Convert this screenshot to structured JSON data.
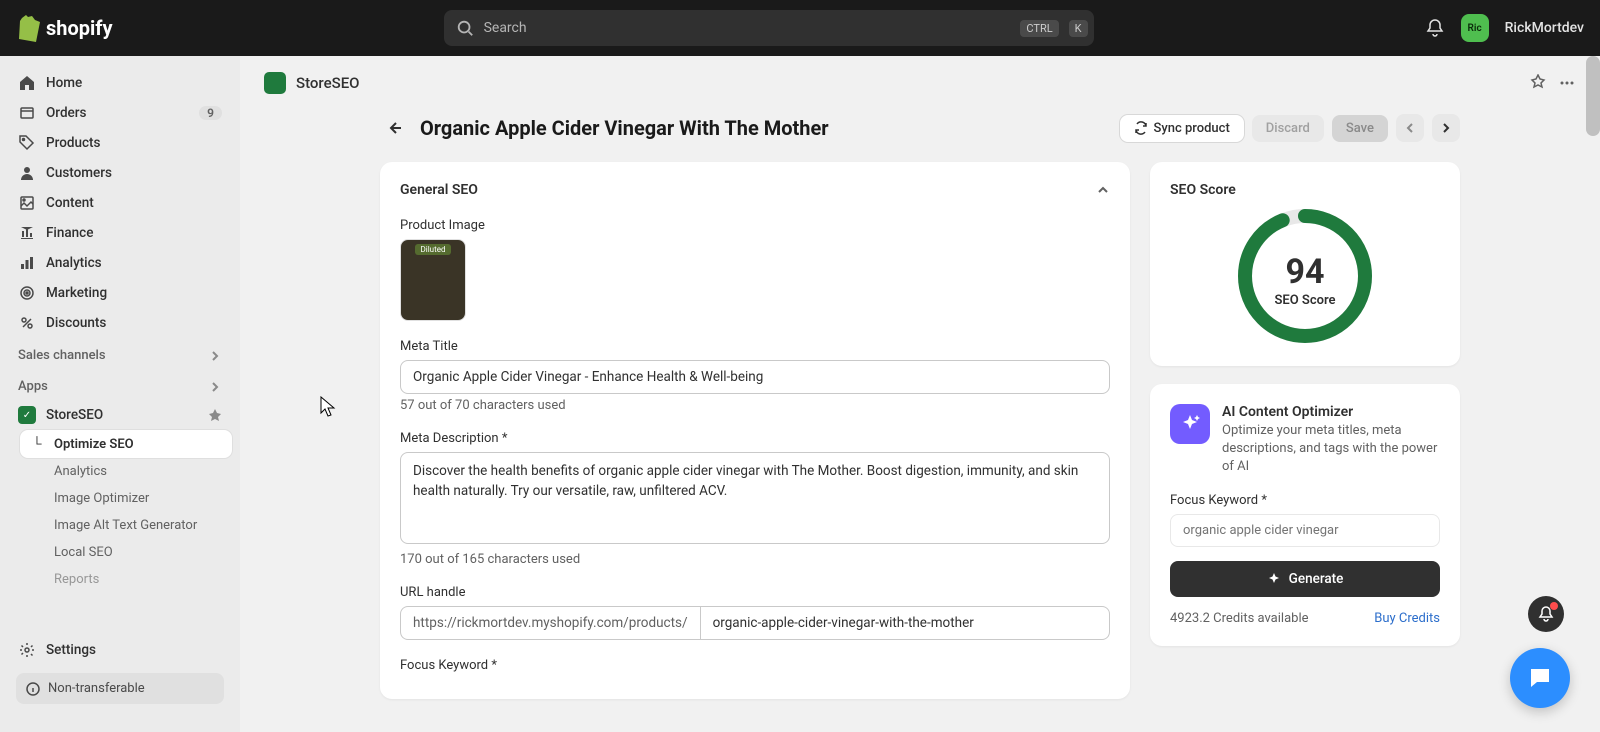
{
  "topbar": {
    "brand": "shopify",
    "search_placeholder": "Search",
    "kbd_ctrl": "CTRL",
    "kbd_k": "K",
    "avatar_initials": "Ric",
    "username": "RickMortdev"
  },
  "sidebar": {
    "items": [
      {
        "label": "Home"
      },
      {
        "label": "Orders",
        "badge": "9"
      },
      {
        "label": "Products"
      },
      {
        "label": "Customers"
      },
      {
        "label": "Content"
      },
      {
        "label": "Finance"
      },
      {
        "label": "Analytics"
      },
      {
        "label": "Marketing"
      },
      {
        "label": "Discounts"
      }
    ],
    "sales_channels": "Sales channels",
    "apps_header": "Apps",
    "app_name": "StoreSEO",
    "sub": [
      {
        "label": "Optimize SEO"
      },
      {
        "label": "Analytics"
      },
      {
        "label": "Image Optimizer"
      },
      {
        "label": "Image Alt Text Generator"
      },
      {
        "label": "Local SEO"
      },
      {
        "label": "Reports"
      }
    ],
    "settings": "Settings",
    "non_transferable": "Non-transferable"
  },
  "app_header": {
    "title": "StoreSEO"
  },
  "page": {
    "title": "Organic Apple Cider Vinegar With The Mother",
    "sync": "Sync product",
    "discard": "Discard",
    "save": "Save"
  },
  "general": {
    "title": "General SEO",
    "product_image_label": "Product Image",
    "product_image_tag": "Diluted",
    "meta_title_label": "Meta Title",
    "meta_title_value": "Organic Apple Cider Vinegar - Enhance Health & Well-being",
    "meta_title_helper": "57 out of 70 characters used",
    "meta_desc_label": "Meta Description",
    "meta_desc_value": "Discover the health benefits of organic apple cider vinegar with The Mother. Boost digestion, immunity, and skin health naturally. Try our versatile, raw, unfiltered ACV.",
    "meta_desc_helper": "170 out of 165 characters used",
    "url_label": "URL handle",
    "url_prefix": "https://rickmortdev.myshopify.com/products/",
    "url_value": "organic-apple-cider-vinegar-with-the-mother",
    "focus_keyword_label": "Focus Keyword"
  },
  "score": {
    "title": "SEO Score",
    "value": "94",
    "sub": "SEO Score"
  },
  "ai": {
    "title": "AI Content Optimizer",
    "desc": "Optimize your meta titles, meta descriptions, and tags with the power of AI",
    "focus_label": "Focus Keyword",
    "focus_placeholder": "organic apple cider vinegar",
    "generate": "Generate",
    "credits": "4923.2 Credits available",
    "buy": "Buy Credits"
  }
}
